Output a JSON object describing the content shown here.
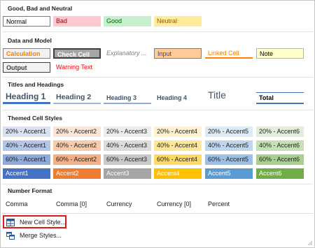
{
  "sections": {
    "good_bad_neutral": {
      "heading": "Good, Bad and Neutral",
      "styles": [
        "Normal",
        "Bad",
        "Good",
        "Neutral"
      ]
    },
    "data_model": {
      "heading": "Data and Model",
      "styles": [
        "Calculation",
        "Check Cell",
        "Explanatory ...",
        "Input",
        "Linked Cell",
        "Note",
        "Output",
        "Warning Text"
      ]
    },
    "titles": {
      "heading": "Titles and Headings",
      "styles": [
        "Heading 1",
        "Heading 2",
        "Heading 3",
        "Heading 4",
        "Title",
        "Total"
      ]
    },
    "themed": {
      "heading": "Themed Cell Styles",
      "row20": [
        "20% - Accent1",
        "20% - Accent2",
        "20% - Accent3",
        "20% - Accent4",
        "20% - Accent5",
        "20% - Accent6"
      ],
      "row40": [
        "40% - Accent1",
        "40% - Accent2",
        "40% - Accent3",
        "40% - Accent4",
        "40% - Accent5",
        "40% - Accent6"
      ],
      "row60": [
        "60% - Accent1",
        "60% - Accent2",
        "60% - Accent3",
        "60% - Accent4",
        "60% - Accent5",
        "60% - Accent6"
      ],
      "accents": [
        "Accent1",
        "Accent2",
        "Accent3",
        "Accent4",
        "Accent5",
        "Accent6"
      ]
    },
    "number_format": {
      "heading": "Number Format",
      "styles": [
        "Comma",
        "Comma [0]",
        "Currency",
        "Currency [0]",
        "Percent"
      ]
    }
  },
  "menu": {
    "new_cell_style": "New Cell Style...",
    "merge_styles": "Merge Styles..."
  },
  "icons": {
    "new_cell_style": "table-style-icon",
    "merge_styles": "merge-styles-icon"
  },
  "colors": {
    "highlight_border": "#e01a1a",
    "accent1": "#4472c4",
    "accent2": "#ed7d31",
    "accent3": "#a5a5a5",
    "accent4": "#ffc000",
    "accent5": "#5b9bd5",
    "accent6": "#70ad47"
  }
}
